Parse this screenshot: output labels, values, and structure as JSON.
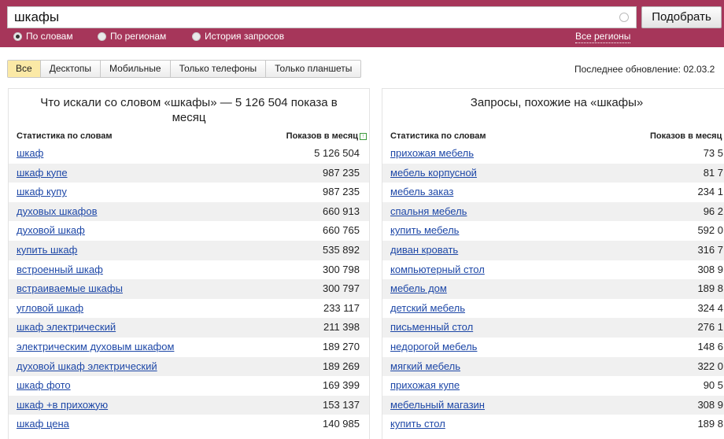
{
  "search": {
    "value": "шкафы",
    "submit_label": "Подобрать"
  },
  "modes": [
    {
      "label": "По словам",
      "selected": true
    },
    {
      "label": "По регионам",
      "selected": false
    },
    {
      "label": "История запросов",
      "selected": false
    }
  ],
  "all_regions_label": "Все регионы",
  "device_tabs": [
    {
      "label": "Все",
      "active": true
    },
    {
      "label": "Десктопы",
      "active": false
    },
    {
      "label": "Мобильные",
      "active": false
    },
    {
      "label": "Только телефоны",
      "active": false
    },
    {
      "label": "Только планшеты",
      "active": false
    }
  ],
  "last_update_label": "Последнее обновление: 02.03.2",
  "left_panel": {
    "title": "Что искали со словом «шкафы» — 5 126 504 показа в месяц",
    "col_phrase": "Статистика по словам",
    "col_count": "Показов в месяц",
    "rows": [
      {
        "phrase": "шкаф",
        "count": "5 126 504"
      },
      {
        "phrase": "шкаф купе",
        "count": "987 235"
      },
      {
        "phrase": "шкаф купу",
        "count": "987 235"
      },
      {
        "phrase": "духовых шкафов",
        "count": "660 913"
      },
      {
        "phrase": "духовой шкаф",
        "count": "660 765"
      },
      {
        "phrase": "купить шкаф",
        "count": "535 892"
      },
      {
        "phrase": "встроенный шкаф",
        "count": "300 798"
      },
      {
        "phrase": "встраиваемые шкафы",
        "count": "300 797"
      },
      {
        "phrase": "угловой шкаф",
        "count": "233 117"
      },
      {
        "phrase": "шкаф электрический",
        "count": "211 398"
      },
      {
        "phrase": "электрическим духовым шкафом",
        "count": "189 270"
      },
      {
        "phrase": "духовой шкаф электрический",
        "count": "189 269"
      },
      {
        "phrase": "шкаф фото",
        "count": "169 399"
      },
      {
        "phrase": "шкаф +в прихожую",
        "count": "153 137"
      },
      {
        "phrase": "шкаф цена",
        "count": "140 985"
      }
    ]
  },
  "right_panel": {
    "title": "Запросы, похожие на «шкафы»",
    "col_phrase": "Статистика по словам",
    "col_count": "Показов в месяц",
    "rows": [
      {
        "phrase": "прихожая мебель",
        "count": "73 5"
      },
      {
        "phrase": "мебель корпусной",
        "count": "81 7"
      },
      {
        "phrase": "мебель заказ",
        "count": "234 1"
      },
      {
        "phrase": "спальня мебель",
        "count": "96 2"
      },
      {
        "phrase": "купить мебель",
        "count": "592 0"
      },
      {
        "phrase": "диван кровать",
        "count": "316 7"
      },
      {
        "phrase": "компьютерный стол",
        "count": "308 9"
      },
      {
        "phrase": "мебель дом",
        "count": "189 8"
      },
      {
        "phrase": "детский мебель",
        "count": "324 4"
      },
      {
        "phrase": "письменный стол",
        "count": "276 1"
      },
      {
        "phrase": "недорогой мебель",
        "count": "148 6"
      },
      {
        "phrase": "мягкий мебель",
        "count": "322 0"
      },
      {
        "phrase": "прихожая купе",
        "count": "90 5"
      },
      {
        "phrase": "мебельный магазин",
        "count": "308 9"
      },
      {
        "phrase": "купить стол",
        "count": "189 8"
      }
    ]
  }
}
